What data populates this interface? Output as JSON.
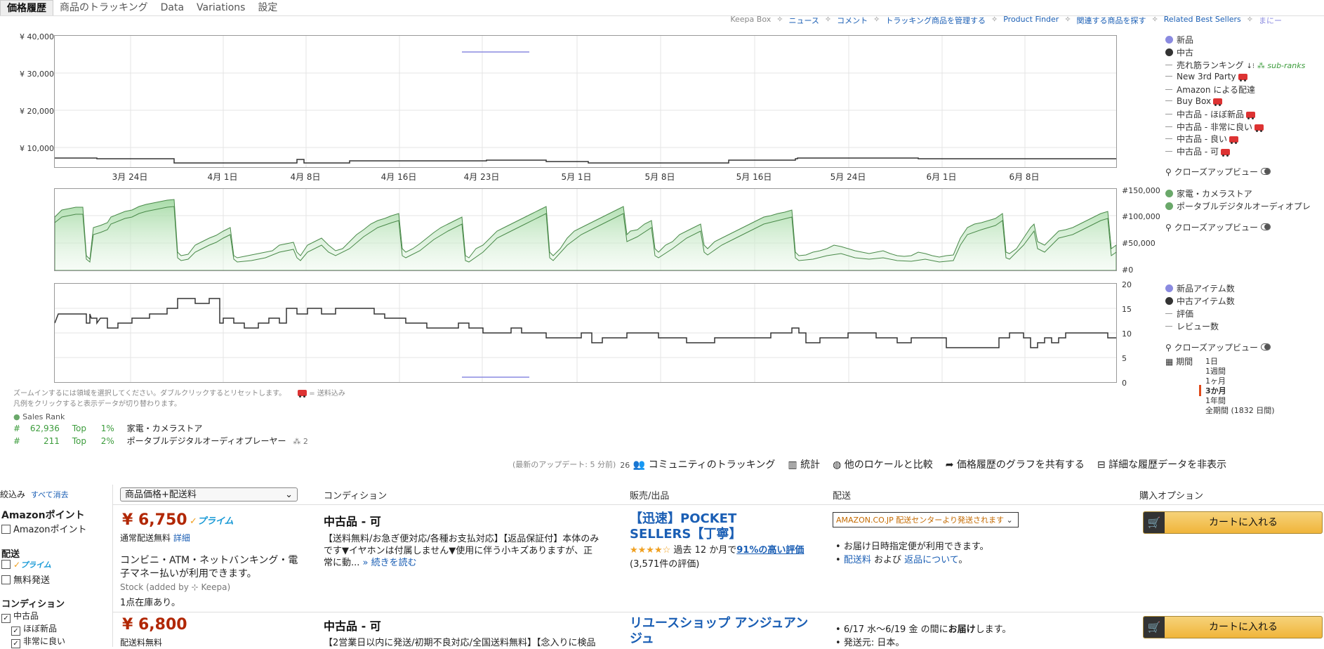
{
  "tabs": [
    "価格履歴",
    "商品のトラッキング",
    "Data",
    "Variations",
    "設定"
  ],
  "topnav": {
    "keepa_box": "Keepa Box",
    "links": [
      "ニュース",
      "コメント",
      "トラッキング商品を管理する",
      "Product Finder",
      "関連する商品を探す",
      "Related Best Sellers"
    ],
    "more": "まにー"
  },
  "chart1": {
    "yticks": [
      "¥ 40,000",
      "¥ 30,000",
      "¥ 20,000",
      "¥ 10,000"
    ],
    "xticks": [
      "3月 24日",
      "4月 1日",
      "4月 8日",
      "4月 16日",
      "4月 23日",
      "5月 1日",
      "5月 8日",
      "5月 16日",
      "5月 24日",
      "6月 1日",
      "6月 8日"
    ]
  },
  "chart2": {
    "yticks": [
      "#150,000",
      "#100,000",
      "#50,000",
      "#0"
    ]
  },
  "chart3": {
    "yticks": [
      "20",
      "15",
      "10",
      "5",
      "0"
    ]
  },
  "legend1": {
    "new": "新品",
    "used": "中古",
    "salesrank": "売れ筋ランキング",
    "subranks": "sub-ranks",
    "new3p": "New 3rd Party",
    "amazon_fba": "Amazon による配達",
    "buybox": "Buy Box",
    "used_like_new": "中古品 - ほぼ新品",
    "used_very_good": "中古品 - 非常に良い",
    "used_good": "中古品 - 良い",
    "used_acceptable": "中古品 - 可",
    "closeup": "クローズアップビュー"
  },
  "legend2": {
    "cat1": "家電・カメラストア",
    "cat2": "ポータブルデジタルオーディオプレ",
    "closeup": "クローズアップビュー"
  },
  "legend3": {
    "new_count": "新品アイテム数",
    "used_count": "中古アイテム数",
    "rating": "評価",
    "reviews": "レビュー数",
    "closeup": "クローズアップビュー",
    "period_label": "期間",
    "periods": [
      "1日",
      "1週間",
      "1ヶ月",
      "3か月",
      "1年間",
      "全期間 (1832 日間)"
    ],
    "active_period": "3か月"
  },
  "info": {
    "zoom_hint": "ズームインするには領域を選択してください。ダブルクリックするとリセットします。",
    "shipping_note": "= 送料込み",
    "legend_hint": "凡例をクリックすると表示データが切り替わります。",
    "sales_rank_label": "Sales Rank",
    "ranks": [
      {
        "hash": "#",
        "rank": "62,936",
        "top": "Top",
        "pct": "1%",
        "category": "家電・カメラストア"
      },
      {
        "hash": "#",
        "rank": "211",
        "top": "Top",
        "pct": "2%",
        "category": "ポータブルデジタルオーディオプレーヤー",
        "sub": "2"
      }
    ]
  },
  "actions": {
    "last_update": "(最新のアップデート: 5 分前)",
    "community_count": "26",
    "community": "コミュニティのトラッキング",
    "stats": "統計",
    "compare": "他のロケールと比較",
    "share": "価格履歴のグラフを共有する",
    "hide": "詳細な履歴データを非表示"
  },
  "offers": {
    "filter_title": "絞込み",
    "clear_all": "すべて消去",
    "sort_select": "商品価格+配送料",
    "headers": [
      "コンディション",
      "販売/出品",
      "配送",
      "購入オプション"
    ],
    "filters": {
      "amazon_points_title": "Amazonポイント",
      "amazon_points": "Amazonポイント",
      "shipping_title": "配送",
      "prime": "プライム",
      "free_shipping": "無料発送",
      "condition_title": "コンディション",
      "used": "中古品",
      "like_new": "ほぼ新品",
      "very_good": "非常に良い"
    },
    "rows": [
      {
        "price": "¥ 6,750",
        "prime": "プライム",
        "shipping": "通常配送無料",
        "details": "詳細",
        "payment": "コンビニ・ATM・ネットバンキング・電子マネー払いが利用できます。",
        "stock": "Stock (added by ⊹ Keepa)",
        "stock_count": "1点在庫あり。",
        "condition": "中古品 - 可",
        "desc": "【送料無料/お急ぎ便対応/各種お支払対応】【返品保証付】本体のみです▼イヤホンは付属しません▼使用に伴う小キズありますが、正常に動...",
        "read_more": "» 続きを読む",
        "seller": "【迅速】POCKET SELLERS【丁寧】",
        "stars": "★★★★☆",
        "rating_text": "過去 12 か月で",
        "rating_pct": "91%の高い評価",
        "rating_count": "(3,571件の評価)",
        "delivery_select": "AMAZON.CO.JP 配送センターより発送されます",
        "delivery_info": "お届け日時指定便が利用できます。",
        "fee_link": "配送料",
        "and": "および",
        "return_link": "返品について",
        "period": "。",
        "cart": "カートに入れる"
      },
      {
        "price": "¥ 6,800",
        "shipping": "配送料無料",
        "condition": "中古品 - 可",
        "desc": "【2営業日以内に発送/初期不良対応/全国送料無料】【念入りに検品",
        "seller": "リユースショップ アンジュアンジュ",
        "delivery1_pre": "6/17 水～6/19 金 の間に",
        "delivery1_bold": "お届け",
        "delivery1_post": "します。",
        "delivery2": "発送元: 日本。",
        "cart": "カートに入れる"
      }
    ]
  },
  "colors": {
    "link": "#1a5eb4",
    "price": "#b12704",
    "rank_green": "#3c9c3c",
    "new_dot": "#8a8ae0",
    "used_dot": "#333333"
  }
}
